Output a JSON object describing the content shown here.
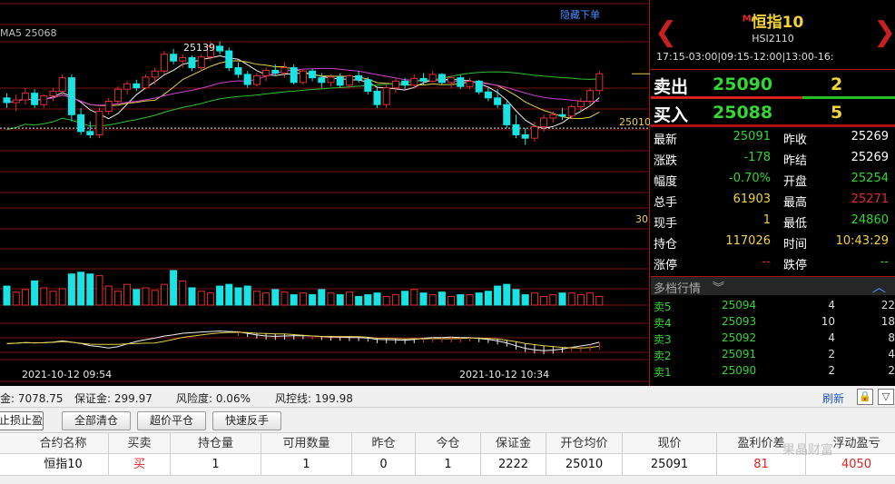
{
  "chart": {
    "ma_label": "MA5 25068",
    "hide_orders_link": "隐藏下单",
    "high_label": "25139",
    "cost_line_label": "25010",
    "axis_label_30": "30",
    "time_left": "2021-10-12 09:54",
    "time_right": "2021-10-12 10:34",
    "colors": {
      "up": "#e03030",
      "down": "#19e3e3",
      "ma_white": "#f0f0f0",
      "ma_yellow": "#e6d14a",
      "ma_magenta": "#d040d0",
      "ma_green": "#30c030",
      "grid": "#7a0f0f"
    }
  },
  "chart_data": {
    "type": "candlestick",
    "title": "恒指10",
    "price_ylim": [
      24860,
      25190
    ],
    "annotations": [
      "MA5 25068",
      "25139",
      "25010"
    ],
    "candles": [
      {
        "o": 25055,
        "h": 25062,
        "l": 25040,
        "c": 25048
      },
      {
        "o": 25048,
        "h": 25060,
        "l": 25035,
        "c": 25052
      },
      {
        "o": 25052,
        "h": 25070,
        "l": 25045,
        "c": 25062
      },
      {
        "o": 25062,
        "h": 25068,
        "l": 25040,
        "c": 25045
      },
      {
        "o": 25045,
        "h": 25060,
        "l": 25040,
        "c": 25058
      },
      {
        "o": 25058,
        "h": 25070,
        "l": 25050,
        "c": 25065
      },
      {
        "o": 25065,
        "h": 25090,
        "l": 25060,
        "c": 25085
      },
      {
        "o": 25085,
        "h": 25090,
        "l": 25020,
        "c": 25030
      },
      {
        "o": 25030,
        "h": 25040,
        "l": 25000,
        "c": 25005
      },
      {
        "o": 25005,
        "h": 25020,
        "l": 24995,
        "c": 25000
      },
      {
        "o": 25000,
        "h": 25040,
        "l": 24995,
        "c": 25035
      },
      {
        "o": 25035,
        "h": 25055,
        "l": 25030,
        "c": 25050
      },
      {
        "o": 25050,
        "h": 25072,
        "l": 25045,
        "c": 25068
      },
      {
        "o": 25068,
        "h": 25080,
        "l": 25060,
        "c": 25076
      },
      {
        "o": 25076,
        "h": 25082,
        "l": 25065,
        "c": 25070
      },
      {
        "o": 25070,
        "h": 25090,
        "l": 25068,
        "c": 25086
      },
      {
        "o": 25086,
        "h": 25100,
        "l": 25075,
        "c": 25095
      },
      {
        "o": 25095,
        "h": 25125,
        "l": 25090,
        "c": 25120
      },
      {
        "o": 25120,
        "h": 25128,
        "l": 25105,
        "c": 25110
      },
      {
        "o": 25110,
        "h": 25120,
        "l": 25100,
        "c": 25115
      },
      {
        "o": 25115,
        "h": 25118,
        "l": 25095,
        "c": 25100
      },
      {
        "o": 25100,
        "h": 25120,
        "l": 25095,
        "c": 25116
      },
      {
        "o": 25116,
        "h": 25139,
        "l": 25110,
        "c": 25132
      },
      {
        "o": 25132,
        "h": 25139,
        "l": 25120,
        "c": 25125
      },
      {
        "o": 25125,
        "h": 25130,
        "l": 25095,
        "c": 25100
      },
      {
        "o": 25100,
        "h": 25108,
        "l": 25085,
        "c": 25090
      },
      {
        "o": 25090,
        "h": 25095,
        "l": 25070,
        "c": 25075
      },
      {
        "o": 25075,
        "h": 25092,
        "l": 25072,
        "c": 25088
      },
      {
        "o": 25088,
        "h": 25100,
        "l": 25080,
        "c": 25096
      },
      {
        "o": 25096,
        "h": 25105,
        "l": 25088,
        "c": 25092
      },
      {
        "o": 25092,
        "h": 25108,
        "l": 25085,
        "c": 25100
      },
      {
        "o": 25100,
        "h": 25105,
        "l": 25075,
        "c": 25078
      },
      {
        "o": 25078,
        "h": 25098,
        "l": 25075,
        "c": 25095
      },
      {
        "o": 25095,
        "h": 25098,
        "l": 25080,
        "c": 25085
      },
      {
        "o": 25085,
        "h": 25092,
        "l": 25070,
        "c": 25078
      },
      {
        "o": 25078,
        "h": 25090,
        "l": 25072,
        "c": 25086
      },
      {
        "o": 25086,
        "h": 25092,
        "l": 25070,
        "c": 25074
      },
      {
        "o": 25074,
        "h": 25090,
        "l": 25070,
        "c": 25088
      },
      {
        "o": 25088,
        "h": 25095,
        "l": 25078,
        "c": 25082
      },
      {
        "o": 25082,
        "h": 25086,
        "l": 25060,
        "c": 25065
      },
      {
        "o": 25065,
        "h": 25070,
        "l": 25040,
        "c": 25045
      },
      {
        "o": 25045,
        "h": 25078,
        "l": 25040,
        "c": 25070
      },
      {
        "o": 25070,
        "h": 25085,
        "l": 25062,
        "c": 25080
      },
      {
        "o": 25080,
        "h": 25085,
        "l": 25068,
        "c": 25074
      },
      {
        "o": 25074,
        "h": 25090,
        "l": 25070,
        "c": 25084
      },
      {
        "o": 25084,
        "h": 25092,
        "l": 25075,
        "c": 25080
      },
      {
        "o": 25080,
        "h": 25095,
        "l": 25078,
        "c": 25090
      },
      {
        "o": 25090,
        "h": 25092,
        "l": 25075,
        "c": 25078
      },
      {
        "o": 25078,
        "h": 25088,
        "l": 25070,
        "c": 25085
      },
      {
        "o": 25085,
        "h": 25090,
        "l": 25068,
        "c": 25072
      },
      {
        "o": 25072,
        "h": 25085,
        "l": 25068,
        "c": 25080
      },
      {
        "o": 25080,
        "h": 25082,
        "l": 25060,
        "c": 25064
      },
      {
        "o": 25064,
        "h": 25070,
        "l": 25050,
        "c": 25055
      },
      {
        "o": 25055,
        "h": 25068,
        "l": 25040,
        "c": 25045
      },
      {
        "o": 25045,
        "h": 25050,
        "l": 25010,
        "c": 25015
      },
      {
        "o": 25015,
        "h": 25030,
        "l": 24995,
        "c": 25000
      },
      {
        "o": 25000,
        "h": 25010,
        "l": 24985,
        "c": 24995
      },
      {
        "o": 24995,
        "h": 25020,
        "l": 24990,
        "c": 25012
      },
      {
        "o": 25012,
        "h": 25030,
        "l": 25005,
        "c": 25025
      },
      {
        "o": 25025,
        "h": 25035,
        "l": 25018,
        "c": 25030
      },
      {
        "o": 25030,
        "h": 25040,
        "l": 25022,
        "c": 25028
      },
      {
        "o": 25028,
        "h": 25045,
        "l": 25025,
        "c": 25042
      },
      {
        "o": 25042,
        "h": 25055,
        "l": 25035,
        "c": 25050
      },
      {
        "o": 25050,
        "h": 25070,
        "l": 25045,
        "c": 25066
      },
      {
        "o": 25066,
        "h": 25095,
        "l": 25060,
        "c": 25091
      }
    ],
    "volume": [
      22,
      15,
      18,
      28,
      20,
      16,
      19,
      36,
      38,
      36,
      34,
      22,
      16,
      24,
      18,
      20,
      17,
      24,
      40,
      28,
      20,
      16,
      14,
      22,
      24,
      20,
      22,
      16,
      14,
      18,
      15,
      12,
      14,
      12,
      18,
      14,
      12,
      15,
      10,
      12,
      14,
      10,
      12,
      16,
      18,
      14,
      12,
      15,
      10,
      12,
      12,
      14,
      16,
      22,
      24,
      18,
      12,
      14,
      10,
      12,
      14,
      14,
      12,
      14,
      10
    ]
  },
  "quote": {
    "prefix": "M",
    "name": "恒指10",
    "code": "HSI2110",
    "sessions": "17:15-03:00|09:15-12:00|13:00-16:",
    "ask_label": "卖出",
    "ask_price": "25090",
    "ask_vol": "2",
    "bid_label": "买入",
    "bid_price": "25088",
    "bid_vol": "5",
    "stats": [
      {
        "k1": "最新",
        "v1": "25091",
        "c1": "green",
        "k2": "昨收",
        "v2": "25269",
        "c2": "white"
      },
      {
        "k1": "涨跌",
        "v1": "-178",
        "c1": "green",
        "k2": "昨结",
        "v2": "25269",
        "c2": "white"
      },
      {
        "k1": "幅度",
        "v1": "-0.70%",
        "c1": "green",
        "k2": "开盘",
        "v2": "25254",
        "c2": "green"
      },
      {
        "k1": "总手",
        "v1": "61903",
        "c1": "yellow",
        "k2": "最高",
        "v2": "25271",
        "c2": "red"
      },
      {
        "k1": "现手",
        "v1": "1",
        "c1": "yellow",
        "k2": "最低",
        "v2": "24860",
        "c2": "green"
      },
      {
        "k1": "持仓",
        "v1": "117026",
        "c1": "yellow",
        "k2": "时间",
        "v2": "10:43:29",
        "c2": "yellow"
      },
      {
        "k1": "涨停",
        "v1": "--",
        "c1": "red",
        "k2": "跌停",
        "v2": "--",
        "c2": "green"
      }
    ],
    "depth_title": "多档行情",
    "depth": [
      {
        "label": "卖5",
        "price": "25094",
        "v1": "4",
        "v2": "22"
      },
      {
        "label": "卖4",
        "price": "25093",
        "v1": "10",
        "v2": "18"
      },
      {
        "label": "卖3",
        "price": "25092",
        "v1": "4",
        "v2": "8"
      },
      {
        "label": "卖2",
        "price": "25091",
        "v1": "2",
        "v2": "4"
      },
      {
        "label": "卖1",
        "price": "25090",
        "v1": "2",
        "v2": "2"
      }
    ]
  },
  "account": {
    "equity_tail": "金: 7078.75",
    "margin": "保证金: 299.97",
    "risk": "风险度: 0.06%",
    "control_line": "风控线: 199.98",
    "refresh": "刷新"
  },
  "toolbar": {
    "tab_sl": "止损止盈",
    "close_all": "全部清仓",
    "over_close": "超价平仓",
    "quick_reverse": "快速反手"
  },
  "positions": {
    "columns": [
      "合约名称",
      "买卖",
      "持仓量",
      "可用数量",
      "昨仓",
      "今仓",
      "保证金",
      "开仓均价",
      "现价",
      "盈利价差",
      "浮动盈亏"
    ],
    "rows": [
      [
        "恒指10",
        "买",
        "1",
        "1",
        "0",
        "1",
        "2222",
        "25010",
        "25091",
        "81",
        "4050"
      ]
    ]
  },
  "watermark": "果晶财富"
}
